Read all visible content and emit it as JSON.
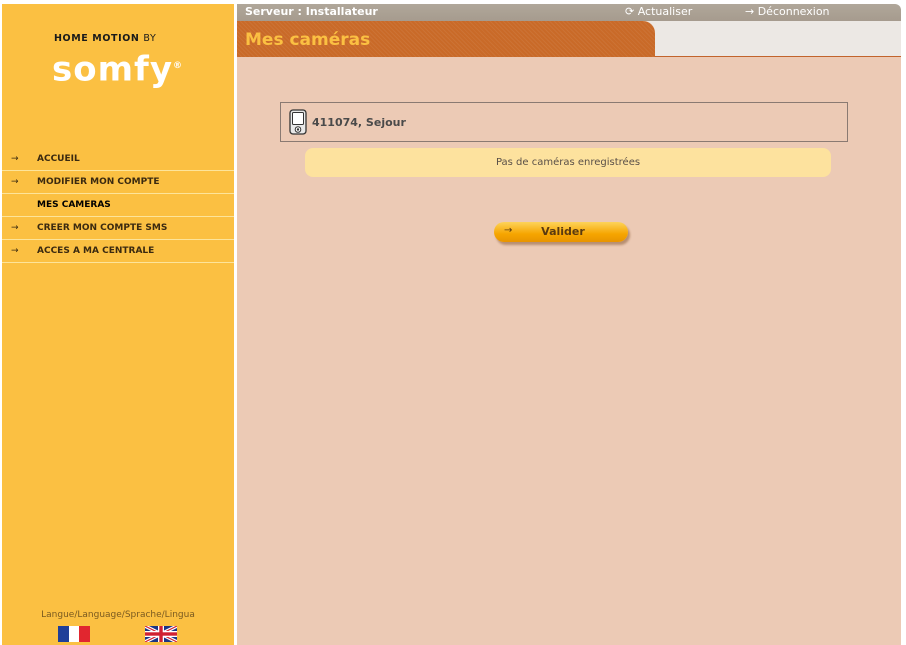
{
  "brand": {
    "top_text": "HOME MOTION",
    "top_by": "BY",
    "logo": "somfy",
    "logo_mark": "®"
  },
  "nav": {
    "arrow": "→",
    "items": [
      {
        "label": "ACCUEIL"
      },
      {
        "label": "MODIFIER MON COMPTE"
      },
      {
        "label": "MES CAMERAS",
        "active": true
      },
      {
        "label": "CREER MON COMPTE SMS"
      },
      {
        "label": "ACCES A MA CENTRALE"
      }
    ]
  },
  "language": {
    "label": "Langue/Language/Sprache/Lingua",
    "options": [
      "fr-flag-icon",
      "en-flag-icon"
    ]
  },
  "topbar": {
    "server": "Serveur : Installateur",
    "refresh": "⟳ Actualiser",
    "logout": "→ Déconnexion"
  },
  "page": {
    "title": "Mes caméras"
  },
  "camera": {
    "name": "411074, Sejour",
    "icon": "camera-icon"
  },
  "message": "Pas de caméras enregistrées",
  "validate": {
    "arrow": "→",
    "label": "Valider"
  },
  "colors": {
    "sidebar": "#fbc042",
    "content": "#eccab5",
    "tab": "#c96a28",
    "title": "#fbc042",
    "message_bg": "#fde29e"
  }
}
